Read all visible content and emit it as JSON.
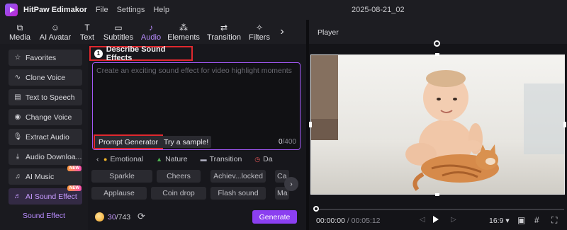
{
  "titlebar": {
    "app_name": "HitPaw Edimakor",
    "menu": [
      "File",
      "Settings",
      "Help"
    ],
    "project_name": "2025-08-21_02"
  },
  "tool_tabs": [
    {
      "label": "Media",
      "icon": "media-icon"
    },
    {
      "label": "AI Avatar",
      "icon": "ai-avatar-icon"
    },
    {
      "label": "Text",
      "icon": "text-icon"
    },
    {
      "label": "Subtitles",
      "icon": "subtitles-icon"
    },
    {
      "label": "Audio",
      "icon": "music-note-icon",
      "active": true
    },
    {
      "label": "Elements",
      "icon": "elements-icon"
    },
    {
      "label": "Transition",
      "icon": "transition-icon"
    },
    {
      "label": "Filters",
      "icon": "filters-icon"
    }
  ],
  "sidebar": {
    "items": [
      {
        "label": "Favorites",
        "icon": "star-icon"
      },
      {
        "label": "Clone Voice",
        "icon": "wave-icon"
      },
      {
        "label": "Text to Speech",
        "icon": "tts-icon"
      },
      {
        "label": "Change Voice",
        "icon": "voice-change-icon"
      },
      {
        "label": "Extract Audio",
        "icon": "microphone-icon"
      },
      {
        "label": "Audio Downloa...",
        "icon": "download-icon"
      },
      {
        "label": "AI Music",
        "icon": "music-icon",
        "badge": "NEW"
      },
      {
        "label": "AI Sound Effect",
        "icon": "sound-effect-icon",
        "badge": "NEW",
        "active": true
      }
    ],
    "sub_label": "Sound Effect"
  },
  "sound_effects": {
    "step_number": "1",
    "title": "Describe Sound Effects",
    "prompt_placeholder": "Create an exciting sound effect for video highlight moments",
    "prompt_generator_label": "Prompt Generator",
    "try_sample_label": "Try a sample!",
    "char_count_current": "0",
    "char_count_max": "/400",
    "categories": [
      {
        "label": "Emotional",
        "icon": "emoji-icon"
      },
      {
        "label": "Nature",
        "icon": "tree-icon"
      },
      {
        "label": "Transition",
        "icon": "transition-icon"
      },
      {
        "label": "Da",
        "icon": "clock-icon"
      }
    ],
    "chips_row1": [
      "Sparkle",
      "Cheers",
      "Achiev...locked",
      "Ca"
    ],
    "chips_row2": [
      "Applause",
      "Coin drop",
      "Flash sound",
      "Ma"
    ],
    "credits_used": "30",
    "credits_total": "/743",
    "generate_label": "Generate"
  },
  "player": {
    "title": "Player",
    "time_current": "00:00:00",
    "time_separator": " / ",
    "time_total": "00:05:12",
    "aspect_ratio": "16:9",
    "playback_position": 0
  }
}
